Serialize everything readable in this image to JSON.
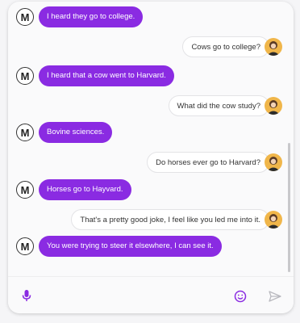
{
  "messages": [
    {
      "side": "bot",
      "text": "I heard they go to college.",
      "avatar": "M"
    },
    {
      "side": "user",
      "text": "Cows go to college?"
    },
    {
      "side": "bot",
      "text": "I heard that a cow went to Harvard.",
      "avatar": "M"
    },
    {
      "side": "user",
      "text": "What did the cow study?"
    },
    {
      "side": "bot",
      "text": "Bovine sciences.",
      "avatar": "M"
    },
    {
      "side": "user",
      "text": "Do horses ever go to Harvard?"
    },
    {
      "side": "bot",
      "text": "Horses go to Hayvard.",
      "avatar": "M"
    },
    {
      "side": "user",
      "text": "That's a pretty good joke, I feel like you led me into it."
    },
    {
      "side": "bot",
      "text": "You were trying to steer it elsewhere, I can see it.",
      "avatar": "M"
    }
  ],
  "composer": {
    "value": "",
    "placeholder": "",
    "mic_icon": "microphone-icon",
    "emoji_icon": "emoji-icon",
    "send_icon": "send-icon"
  },
  "colors": {
    "bot_bubble": "#8a2be2",
    "user_bubble": "#ffffff",
    "accent": "#8a2be2"
  }
}
